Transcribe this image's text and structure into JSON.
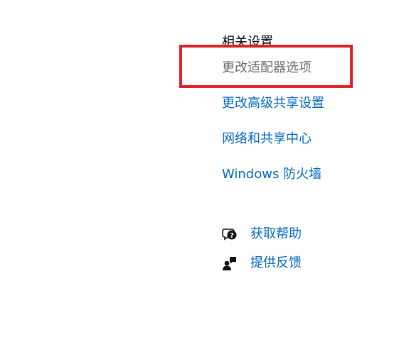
{
  "related_settings": {
    "title": "相关设置",
    "links": [
      {
        "label": "更改适配器选项",
        "state": "highlighted"
      },
      {
        "label": "更改高级共享设置"
      },
      {
        "label": "网络和共享中心"
      },
      {
        "label": "Windows 防火墙"
      }
    ]
  },
  "support": {
    "get_help": {
      "label": "获取帮助",
      "icon": "chat-help-icon"
    },
    "give_feedback": {
      "label": "提供反馈",
      "icon": "feedback-person-icon"
    }
  },
  "colors": {
    "link": "#0067c0",
    "highlight_border": "#e0202a",
    "muted_link": "#6b6b6b"
  }
}
